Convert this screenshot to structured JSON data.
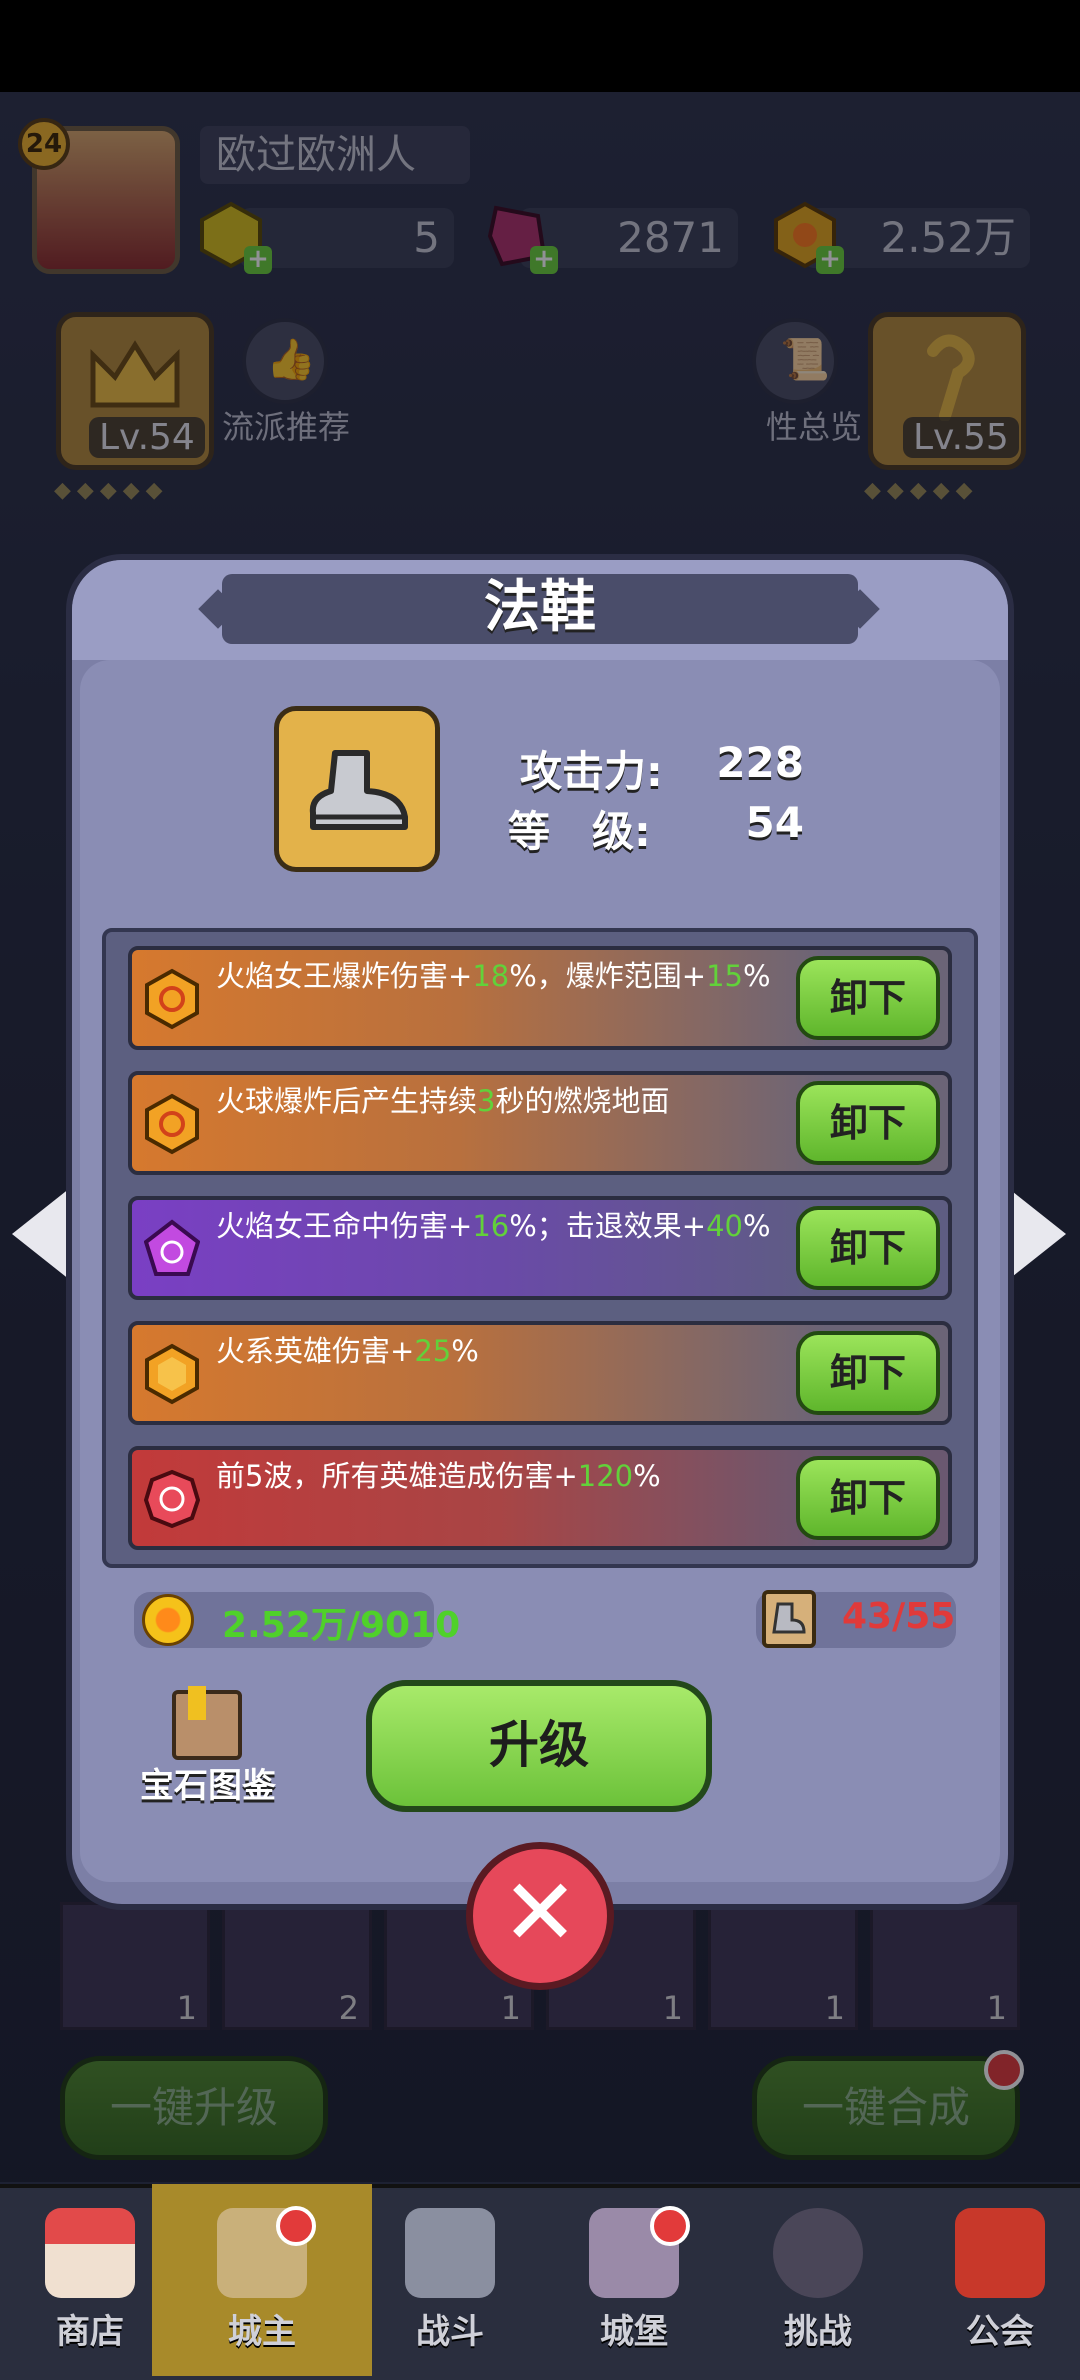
{
  "player": {
    "level": "24",
    "name": "欧过欧洲人"
  },
  "resources": [
    {
      "icon": "gold-gem-icon",
      "value": "5"
    },
    {
      "icon": "purple-crystal-icon",
      "value": "2871"
    },
    {
      "icon": "coin-icon",
      "value": "2.52万"
    }
  ],
  "left_card": {
    "level": "Lv.54",
    "icon": "crown-icon"
  },
  "right_card": {
    "level": "Lv.55",
    "icon": "staff-icon"
  },
  "left_button_label": "流派推荐",
  "right_button_label": "性总览",
  "modal": {
    "title": "法鞋",
    "item_icon": "boot-icon",
    "stats": [
      {
        "label": "攻击力:",
        "value": "228"
      },
      {
        "label": "等　级:",
        "value": "54"
      }
    ],
    "gems": [
      {
        "color": "orange",
        "icon": "orange-hexagon-gem-icon",
        "segments": [
          "火焰女王爆炸伤害+",
          "18",
          "%，爆炸范围+",
          "15",
          "%"
        ],
        "button": "卸下"
      },
      {
        "color": "orange",
        "icon": "orange-hexagon-gem-icon",
        "segments": [
          "火球爆炸后产生持续",
          "3",
          "秒的燃烧地面",
          "",
          ""
        ],
        "button": "卸下"
      },
      {
        "color": "purple",
        "icon": "purple-pentagon-gem-icon",
        "segments": [
          "火焰女王命中伤害+",
          "16",
          "%；击退效果+",
          "40",
          "%"
        ],
        "button": "卸下"
      },
      {
        "color": "orange",
        "icon": "orange-hexagon-gem-icon",
        "segments": [
          "火系英雄伤害+",
          "25",
          "%",
          "",
          ""
        ],
        "button": "卸下"
      },
      {
        "color": "red",
        "icon": "red-round-gem-icon",
        "segments": [
          "前5波，所有英雄造成伤害+",
          "120",
          "%",
          "",
          ""
        ],
        "button": "卸下"
      }
    ],
    "gold_cost": "2.52万/9010",
    "scroll_cost": "43/55",
    "codex_label": "宝石图鉴",
    "upgrade_label": "升级",
    "colors": {
      "highlight": "#62d13a",
      "gold_cost": "#4fd12a",
      "scroll_cost": "#e03a3a"
    }
  },
  "gem_slots": [
    "1",
    "2",
    "1",
    "1",
    "1",
    "1"
  ],
  "bottom_buttons": {
    "left": "一键升级",
    "right": "一键合成"
  },
  "nav": [
    {
      "label": "商店",
      "icon": "shop-icon"
    },
    {
      "label": "城主",
      "icon": "lord-icon"
    },
    {
      "label": "战斗",
      "icon": "swords-icon"
    },
    {
      "label": "城堡",
      "icon": "castle-icon"
    },
    {
      "label": "挑战",
      "icon": "demon-icon"
    },
    {
      "label": "公会",
      "icon": "guild-banner-icon"
    }
  ]
}
